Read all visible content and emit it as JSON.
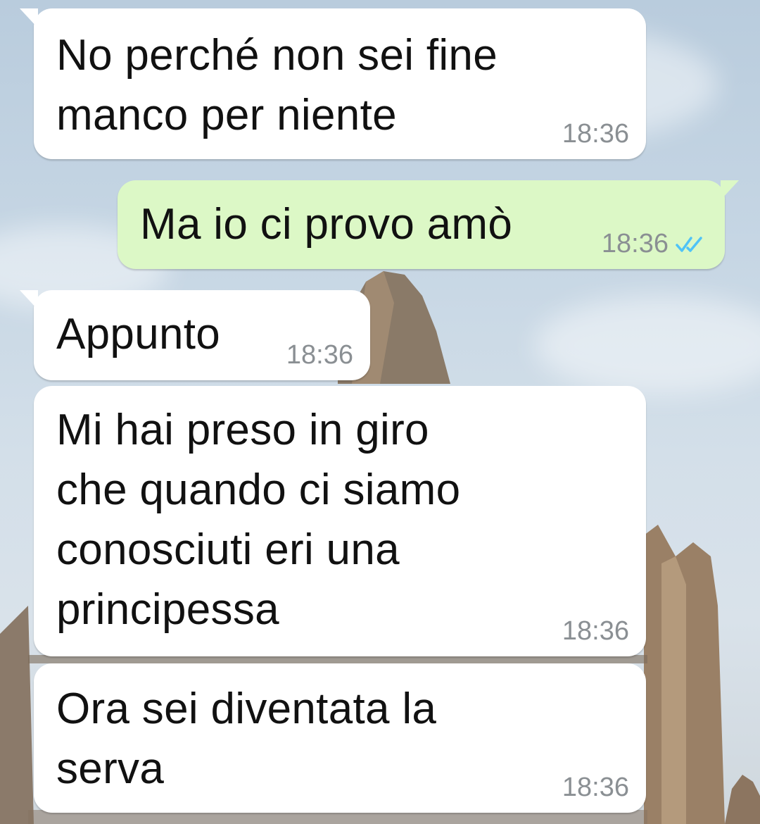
{
  "messages": [
    {
      "direction": "incoming",
      "text": "No perché non sei fine\nmanco per niente",
      "time": "18:36"
    },
    {
      "direction": "outgoing",
      "text": "Ma io ci provo amò",
      "time": "18:36",
      "status_icon": "double-check-icon",
      "status_color": "#4fc3f7"
    },
    {
      "direction": "incoming",
      "text": "Appunto",
      "time": "18:36"
    },
    {
      "direction": "incoming",
      "text": "Mi hai preso in giro\nche quando ci siamo\nconosciuti eri una\nprincipessa",
      "time": "18:36"
    },
    {
      "direction": "incoming",
      "text": "Ora sei diventata la\nserva",
      "time": "18:36"
    }
  ],
  "colors": {
    "incoming_bubble": "#ffffff",
    "outgoing_bubble": "#dcf8c6",
    "timestamp": "#8a8f93",
    "read_ticks": "#4fc3f7"
  }
}
